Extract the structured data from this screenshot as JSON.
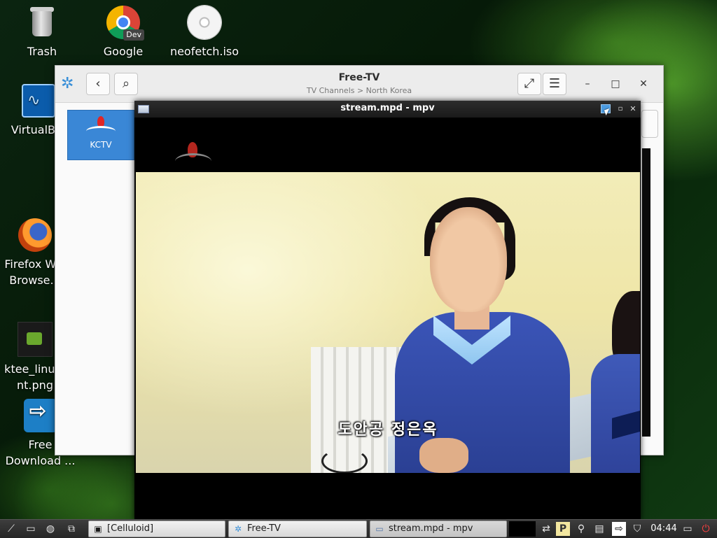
{
  "desktop": {
    "icons": [
      {
        "label": "Trash"
      },
      {
        "label": "Google Chrome (u..."
      },
      {
        "label": "neofetch.iso"
      },
      {
        "label": "VirtualB..."
      },
      {
        "label": "Firefox W... Browse..."
      },
      {
        "label": "ktee_linu... nt.png"
      },
      {
        "label": "Free Download ..."
      }
    ],
    "chrome_badge": "Dev"
  },
  "freetv": {
    "title": "Free-TV",
    "subtitle": "TV Channels > North Korea",
    "channels": [
      {
        "name": "KCTV"
      }
    ]
  },
  "mpv": {
    "title": "stream.mpd - mpv",
    "subtitle_text": "도안공 정은옥"
  },
  "taskbar": {
    "tasks": [
      {
        "label": "[Celluloid]"
      },
      {
        "label": "Free-TV"
      },
      {
        "label": "stream.mpd - mpv"
      }
    ],
    "clock": "04:44"
  },
  "colors": {
    "accent": "#3a87d6",
    "mpv_titlebar": "#1a1a1a",
    "desktop_green": "#0b2410"
  }
}
